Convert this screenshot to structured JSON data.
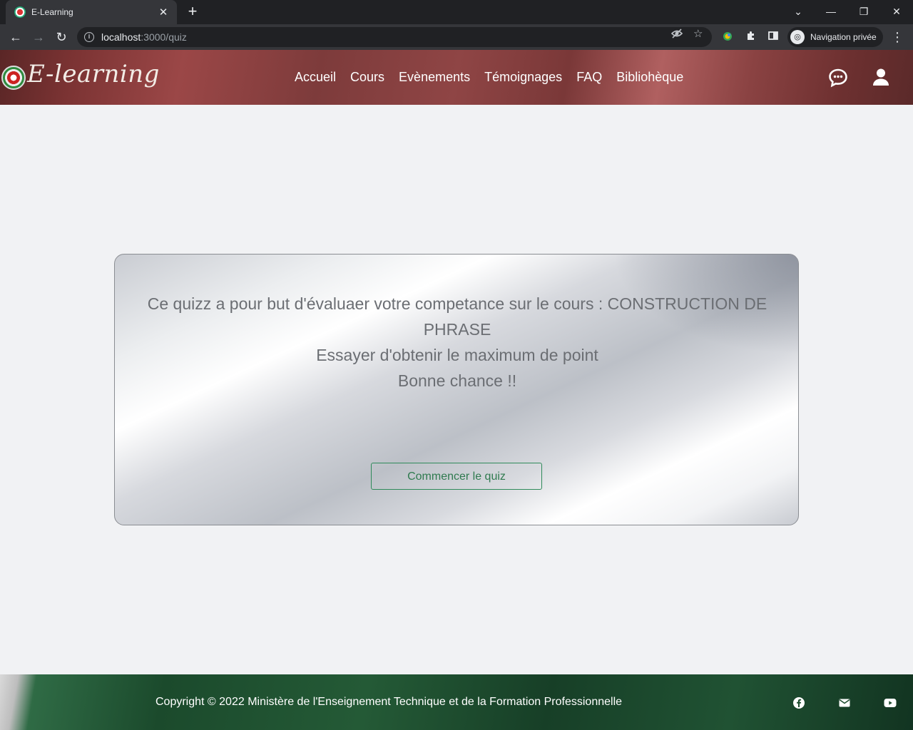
{
  "browser": {
    "tab_title": "E-Learning",
    "url_host": "localhost",
    "url_path": ":3000/quiz",
    "private_label": "Navigation privée"
  },
  "site": {
    "logo_text": "E-learning",
    "nav": [
      "Accueil",
      "Cours",
      "Evènements",
      "Témoignages",
      "FAQ",
      "Bibliohèque"
    ]
  },
  "quiz": {
    "intro_line1": "Ce quizz a pour but d'évaluaer votre competance sur le cours : CONSTRUCTION DE PHRASE",
    "intro_line2": "Essayer d'obtenir le maximum de point",
    "intro_line3": "Bonne chance !!",
    "start_button": "Commencer le quiz"
  },
  "footer": {
    "copyright": "Copyright © 2022 Ministère de l'Enseignement Technique et de la Formation Professionnelle"
  },
  "icons": {
    "chat": "chat-bubble-icon",
    "user": "user-icon",
    "facebook": "facebook-icon",
    "mail": "mail-icon",
    "youtube": "youtube-icon"
  }
}
